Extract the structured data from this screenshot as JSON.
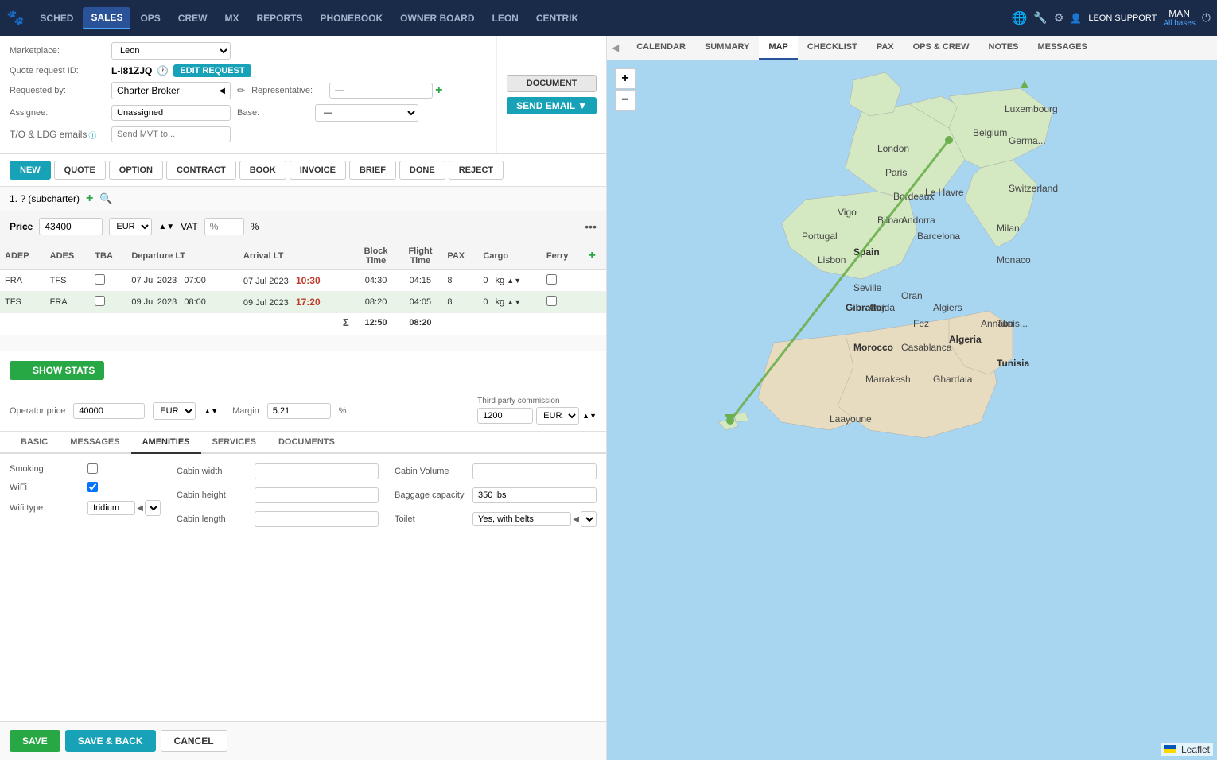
{
  "nav": {
    "items": [
      {
        "id": "sched",
        "label": "SCHED",
        "active": false
      },
      {
        "id": "sales",
        "label": "SALES",
        "active": true
      },
      {
        "id": "ops",
        "label": "OPS",
        "active": false
      },
      {
        "id": "crew",
        "label": "CREW",
        "active": false
      },
      {
        "id": "mx",
        "label": "MX",
        "active": false
      },
      {
        "id": "reports",
        "label": "REPORTS",
        "active": false
      },
      {
        "id": "phonebook",
        "label": "PHONEBOOK",
        "active": false
      },
      {
        "id": "owner_board",
        "label": "OWNER BOARD",
        "active": false
      },
      {
        "id": "leon",
        "label": "LEON",
        "active": false
      },
      {
        "id": "centrik",
        "label": "CENTRIK",
        "active": false
      }
    ],
    "user": "LEON SUPPORT",
    "manager": "MAN",
    "all_bases": "All bases"
  },
  "form": {
    "marketplace_label": "Marketplace:",
    "marketplace_value": "Leon",
    "quote_id_label": "Quote request ID:",
    "quote_id": "L-I81ZJQ",
    "edit_button": "EDIT REQUEST",
    "requested_by_label": "Requested by:",
    "requested_by": "Charter Broker",
    "representative_label": "Representative:",
    "representative_value": "—",
    "assignee_label": "Assignee:",
    "assignee_value": "Unassigned",
    "base_label": "Base:",
    "base_value": "—",
    "tldg_label": "T/O & LDG emails",
    "tldg_placeholder": "Send MVT to..."
  },
  "action_buttons": {
    "new": "NEW",
    "quote": "QUOTE",
    "option": "OPTION",
    "contract": "CONTRACT",
    "book": "BOOK",
    "invoice": "INVOICE",
    "brief": "BRIEF",
    "done": "DONE",
    "reject": "REJECT"
  },
  "top_buttons": {
    "document": "DOCUMENT",
    "send_email": "SEND EMAIL"
  },
  "subcharter": {
    "label": "1. ? (subcharter)"
  },
  "price_row": {
    "label": "Price",
    "value": "43400",
    "currency": "EUR",
    "vat_label": "VAT",
    "vat_placeholder": "%"
  },
  "flight_table": {
    "headers": [
      "ADEP",
      "ADES",
      "TBA",
      "Departure LT",
      "Arrival LT",
      "Block Time",
      "Flight Time",
      "PAX",
      "Cargo",
      "Ferry"
    ],
    "rows": [
      {
        "adep": "FRA",
        "ades": "TFS",
        "tba": false,
        "dep_date": "07 Jul 2023",
        "dep_time": "07:00",
        "arr_date": "07 Jul 2023",
        "arr_time": "10:30",
        "block_time": "04:30",
        "flight_time": "04:15",
        "pax": "8",
        "cargo": "0",
        "cargo_unit": "kg",
        "ferry": false,
        "highlight": false
      },
      {
        "adep": "TFS",
        "ades": "FRA",
        "tba": false,
        "dep_date": "09 Jul 2023",
        "dep_time": "08:00",
        "arr_date": "09 Jul 2023",
        "arr_time": "17:20",
        "block_time": "08:20",
        "flight_time": "04:05",
        "pax": "8",
        "cargo": "0",
        "cargo_unit": "kg",
        "ferry": false,
        "highlight": true
      }
    ],
    "totals": {
      "block_time": "12:50",
      "flight_time": "08:20"
    }
  },
  "show_stats": {
    "button": "SHOW STATS"
  },
  "operator_section": {
    "operator_price_label": "Operator price",
    "operator_price": "40000",
    "currency": "EUR",
    "margin_label": "Margin",
    "margin_value": "5.21",
    "third_party_label": "Third party commission",
    "third_party_value": "1200",
    "third_currency": "EUR"
  },
  "tabs": {
    "items": [
      "BASIC",
      "MESSAGES",
      "AMENITIES",
      "SERVICES",
      "DOCUMENTS"
    ],
    "active": "AMENITIES"
  },
  "amenities": {
    "smoking_label": "Smoking",
    "smoking_checked": false,
    "wifi_label": "WiFi",
    "wifi_checked": true,
    "wifi_type_label": "Wifi type",
    "wifi_type_value": "Iridium",
    "cabin_width_label": "Cabin width",
    "cabin_width_value": "",
    "cabin_height_label": "Cabin height",
    "cabin_height_value": "",
    "cabin_length_label": "Cabin length",
    "cabin_length_value": "",
    "cabin_volume_label": "Cabin Volume",
    "cabin_volume_value": "",
    "baggage_label": "Baggage capacity",
    "baggage_value": "350 lbs",
    "toilet_label": "Toilet",
    "toilet_value": "Yes, with belts"
  },
  "bottom_actions": {
    "save": "SAVE",
    "save_back": "SAVE & BACK",
    "cancel": "CANCEL"
  },
  "map_tabs": {
    "items": [
      "CALENDAR",
      "SUMMARY",
      "MAP",
      "CHECKLIST",
      "PAX",
      "OPS & CREW",
      "NOTES",
      "MESSAGES"
    ],
    "active": "MAP"
  },
  "map": {
    "zoom_in": "+",
    "zoom_out": "−",
    "leaflet_credit": "Leaflet"
  }
}
